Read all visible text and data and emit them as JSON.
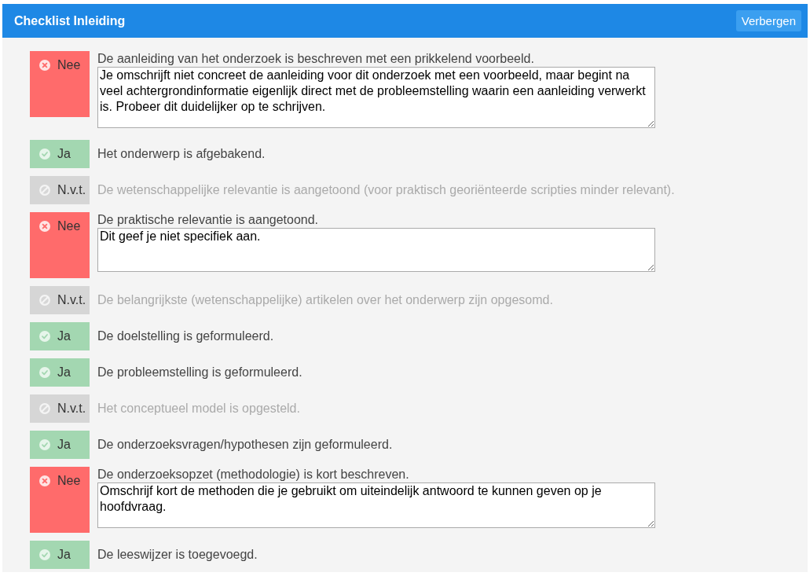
{
  "panel": {
    "title": "Checklist Inleiding",
    "hide_button": "Verbergen"
  },
  "items": [
    {
      "kind": "no",
      "label": "Nee",
      "question": "De aanleiding van het onderzoek is beschreven met een prikkelend voorbeeld.",
      "comment": "Je omschrijft niet concreet de aanleiding voor dit onderzoek met een voorbeeld, maar begint na veel achtergrondinformatie eigenlijk direct met de probleemstelling waarin een aanleiding verwerkt is. Probeer dit duidelijker op te schrijven."
    },
    {
      "kind": "yes",
      "label": "Ja",
      "question": "Het onderwerp is afgebakend."
    },
    {
      "kind": "na",
      "label": "N.v.t.",
      "question": "De wetenschappelijke relevantie is aangetoond (voor praktisch georiënteerde scripties minder relevant)."
    },
    {
      "kind": "no",
      "label": "Nee",
      "question": "De praktische relevantie is aangetoond.",
      "comment": "Dit geef je niet specifiek aan."
    },
    {
      "kind": "na",
      "label": "N.v.t.",
      "question": "De belangrijkste (wetenschappelijke) artikelen over het onderwerp zijn opgesomd."
    },
    {
      "kind": "yes",
      "label": "Ja",
      "question": "De doelstelling is geformuleerd."
    },
    {
      "kind": "yes",
      "label": "Ja",
      "question": "De probleemstelling is geformuleerd."
    },
    {
      "kind": "na",
      "label": "N.v.t.",
      "question": "Het conceptueel model is opgesteld."
    },
    {
      "kind": "yes",
      "label": "Ja",
      "question": "De onderzoeksvragen/hypothesen zijn geformuleerd."
    },
    {
      "kind": "no",
      "label": "Nee",
      "question": "De onderzoeksopzet (methodologie) is kort beschreven.",
      "comment": "Omschrijf kort de methoden die je gebruikt om uiteindelijk antwoord te kunnen geven op je hoofdvraag."
    },
    {
      "kind": "yes",
      "label": "Ja",
      "question": "De leeswijzer is toegevoegd."
    }
  ]
}
